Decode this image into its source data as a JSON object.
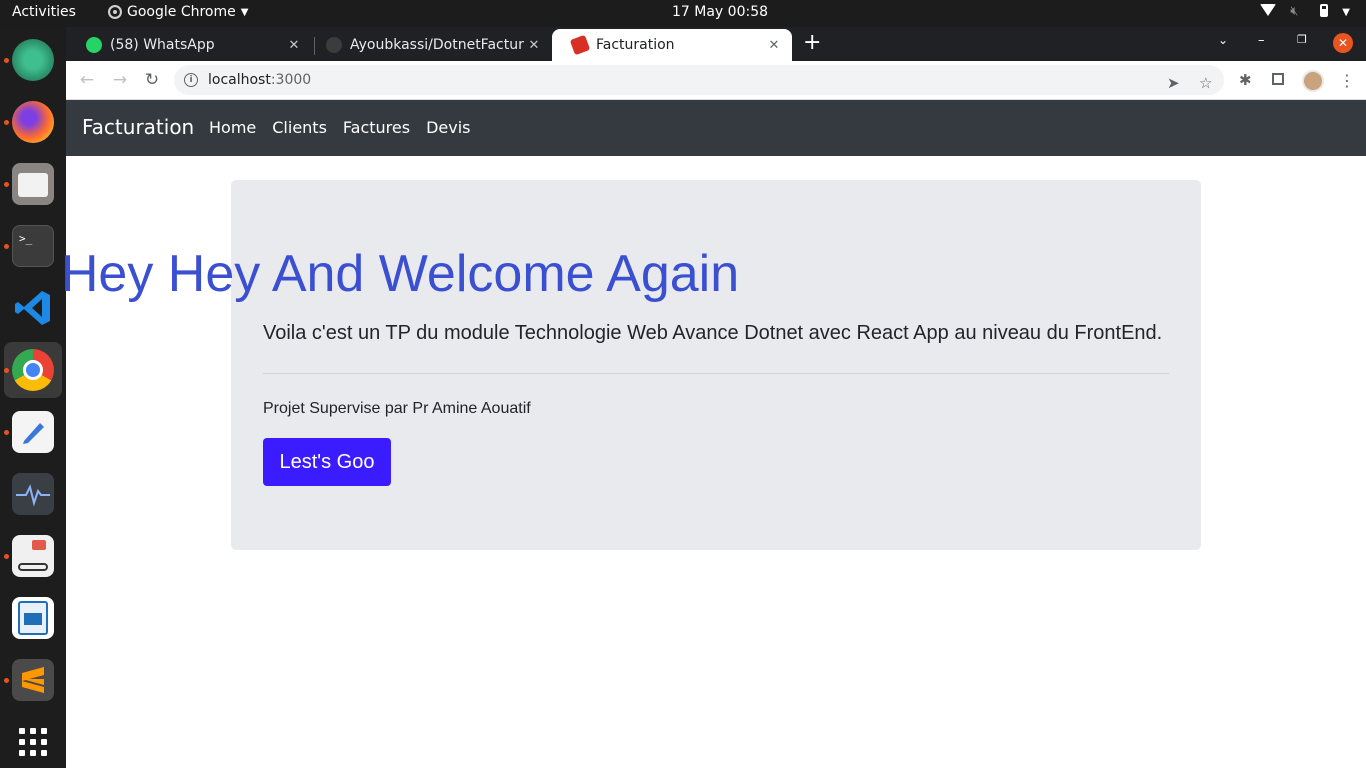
{
  "system_bar": {
    "activities": "Activities",
    "app_name": "Google Chrome",
    "clock": "17 May  00:58"
  },
  "dock": {
    "apps": [
      "atom-icon",
      "firefox-icon",
      "files-icon",
      "terminal-icon",
      "vscode-icon",
      "chrome-icon",
      "text-editor-icon",
      "system-monitor-icon",
      "document-viewer-icon",
      "libreoffice-writer-icon",
      "sublime-text-icon",
      "show-applications-icon"
    ]
  },
  "browser": {
    "tabs": [
      {
        "title": "(58) WhatsApp",
        "favicon_color": "#25d366"
      },
      {
        "title": "Ayoubkassi/DotnetFactur",
        "favicon_color": "#3c3c3c"
      },
      {
        "title": "Facturation",
        "favicon_color": "#d93025"
      }
    ],
    "address": {
      "host": "localhost",
      "port": ":3000"
    }
  },
  "page": {
    "navbar": {
      "brand": "Facturation",
      "links": [
        "Home",
        "Clients",
        "Factures",
        "Devis"
      ]
    },
    "jumbotron": {
      "title": "Hey Hey And Welcome Again",
      "lead": "Voila c'est un TP du module Technologie Web Avance Dotnet avec React App au niveau du FrontEnd.",
      "supervision": "Projet Supervise par Pr Amine Aouatif",
      "button": "Lest's Goo"
    }
  },
  "colors": {
    "title_blue": "#3b4fd1",
    "button_blue": "#3b1bff",
    "navbar_bg": "#343a40",
    "jumbotron_bg": "#e9eaee"
  }
}
